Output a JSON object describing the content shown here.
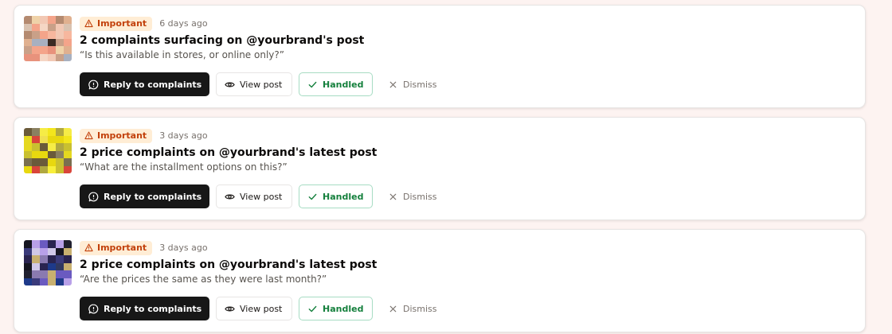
{
  "colors": {
    "important_bg": "#ffedd5",
    "important_text": "#c2410c",
    "primary_button": "#171717",
    "handled_text": "#15803d",
    "handled_border": "#a7dcc3"
  },
  "notifications": [
    {
      "badge": "Important",
      "badge_icon": "warning-triangle-icon",
      "time": "6 days ago",
      "title": "2 complaints surfacing on @yourbrand's post",
      "quote": "“Is this available in stores, or online only?”",
      "actions": {
        "reply": "Reply to complaints",
        "view": "View post",
        "handled": "Handled",
        "dismiss": "Dismiss"
      }
    },
    {
      "badge": "Important",
      "badge_icon": "warning-triangle-icon",
      "time": "3 days ago",
      "title": "2 price complaints on @yourbrand's latest post",
      "quote": "“What are the installment options on this?”",
      "actions": {
        "reply": "Reply to complaints",
        "view": "View post",
        "handled": "Handled",
        "dismiss": "Dismiss"
      }
    },
    {
      "badge": "Important",
      "badge_icon": "warning-triangle-icon",
      "time": "3 days ago",
      "title": "2 price complaints on @yourbrand's latest post",
      "quote": "“Are the prices the same as they were last month?”",
      "actions": {
        "reply": "Reply to complaints",
        "view": "View post",
        "handled": "Handled",
        "dismiss": "Dismiss"
      }
    }
  ]
}
